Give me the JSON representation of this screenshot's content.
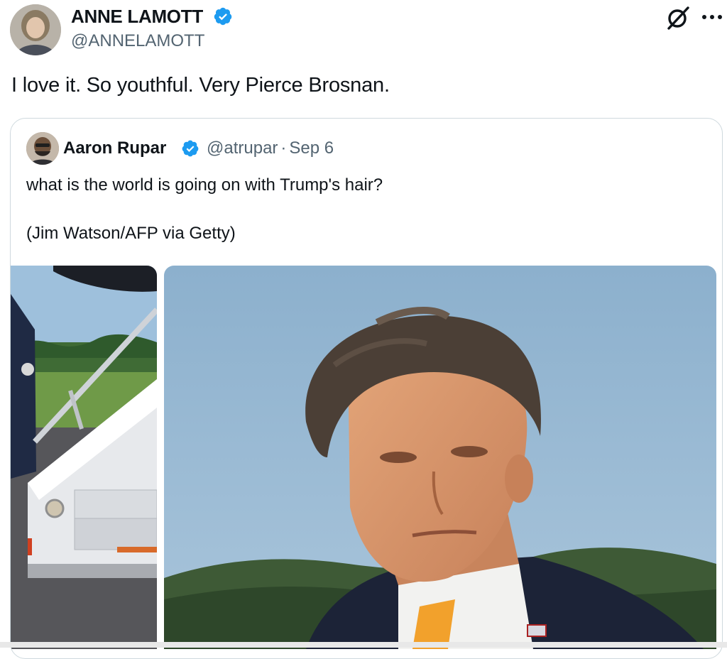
{
  "post": {
    "author_name": "ANNE LAMOTT",
    "author_handle": "@ANNELAMOTT",
    "text": "I love it. So youthful. Very Pierce Brosnan.",
    "icons": {
      "verified": "verified-badge-icon",
      "grok": "grok-icon",
      "more": "more-options-icon"
    }
  },
  "quoted_post": {
    "author_name": "Aaron Rupar",
    "author_handle": "@atrupar",
    "separator": "·",
    "date": "Sep 6",
    "text": "what is the world is going on with Trump's hair?",
    "credit": "(Jim Watson/AFP via Getty)"
  },
  "colors": {
    "verified_blue": "#1d9bf0",
    "secondary_text": "#536471",
    "border": "#cfd9de",
    "sky": "#8fb2cf",
    "tie_orange": "#f2a12c"
  }
}
